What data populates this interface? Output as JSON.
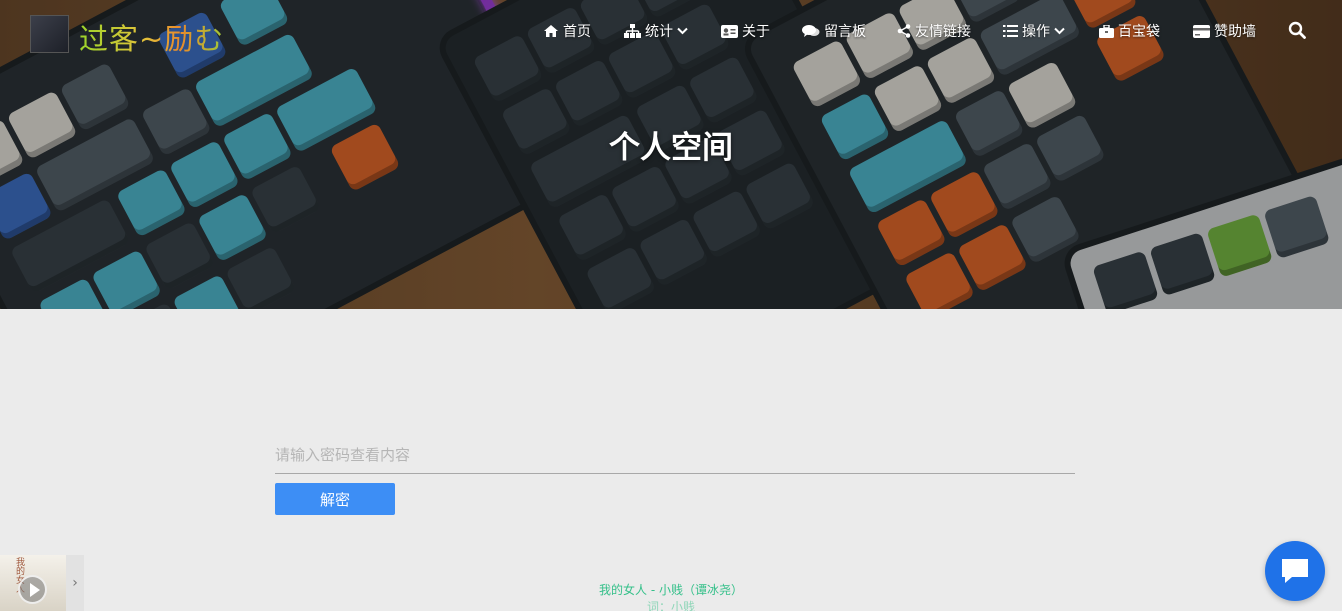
{
  "site": {
    "logo_text": "过客~励む"
  },
  "nav": {
    "items": [
      {
        "label": "首页",
        "icon": "home-icon"
      },
      {
        "label": "统计",
        "icon": "sitemap-icon",
        "dropdown": true
      },
      {
        "label": "关于",
        "icon": "id-card-icon"
      },
      {
        "label": "留言板",
        "icon": "comments-icon"
      },
      {
        "label": "友情链接",
        "icon": "share-icon"
      },
      {
        "label": "操作",
        "icon": "list-icon",
        "dropdown": true
      },
      {
        "label": "百宝袋",
        "icon": "briefcase-icon"
      },
      {
        "label": "赞助墙",
        "icon": "credit-card-icon"
      }
    ],
    "search_icon": "search-icon"
  },
  "hero": {
    "title": "个人空间"
  },
  "protected": {
    "placeholder": "请输入密码查看内容",
    "button_label": "解密"
  },
  "player": {
    "song_title": "我的女人 - 小贱（谭冰尧）",
    "lyric_line": "词：小贱",
    "cover_text": "我的女人"
  },
  "colors": {
    "accent": "#3d8ef5",
    "chat_button": "#1f72e8",
    "song_text": "#35c08a"
  }
}
